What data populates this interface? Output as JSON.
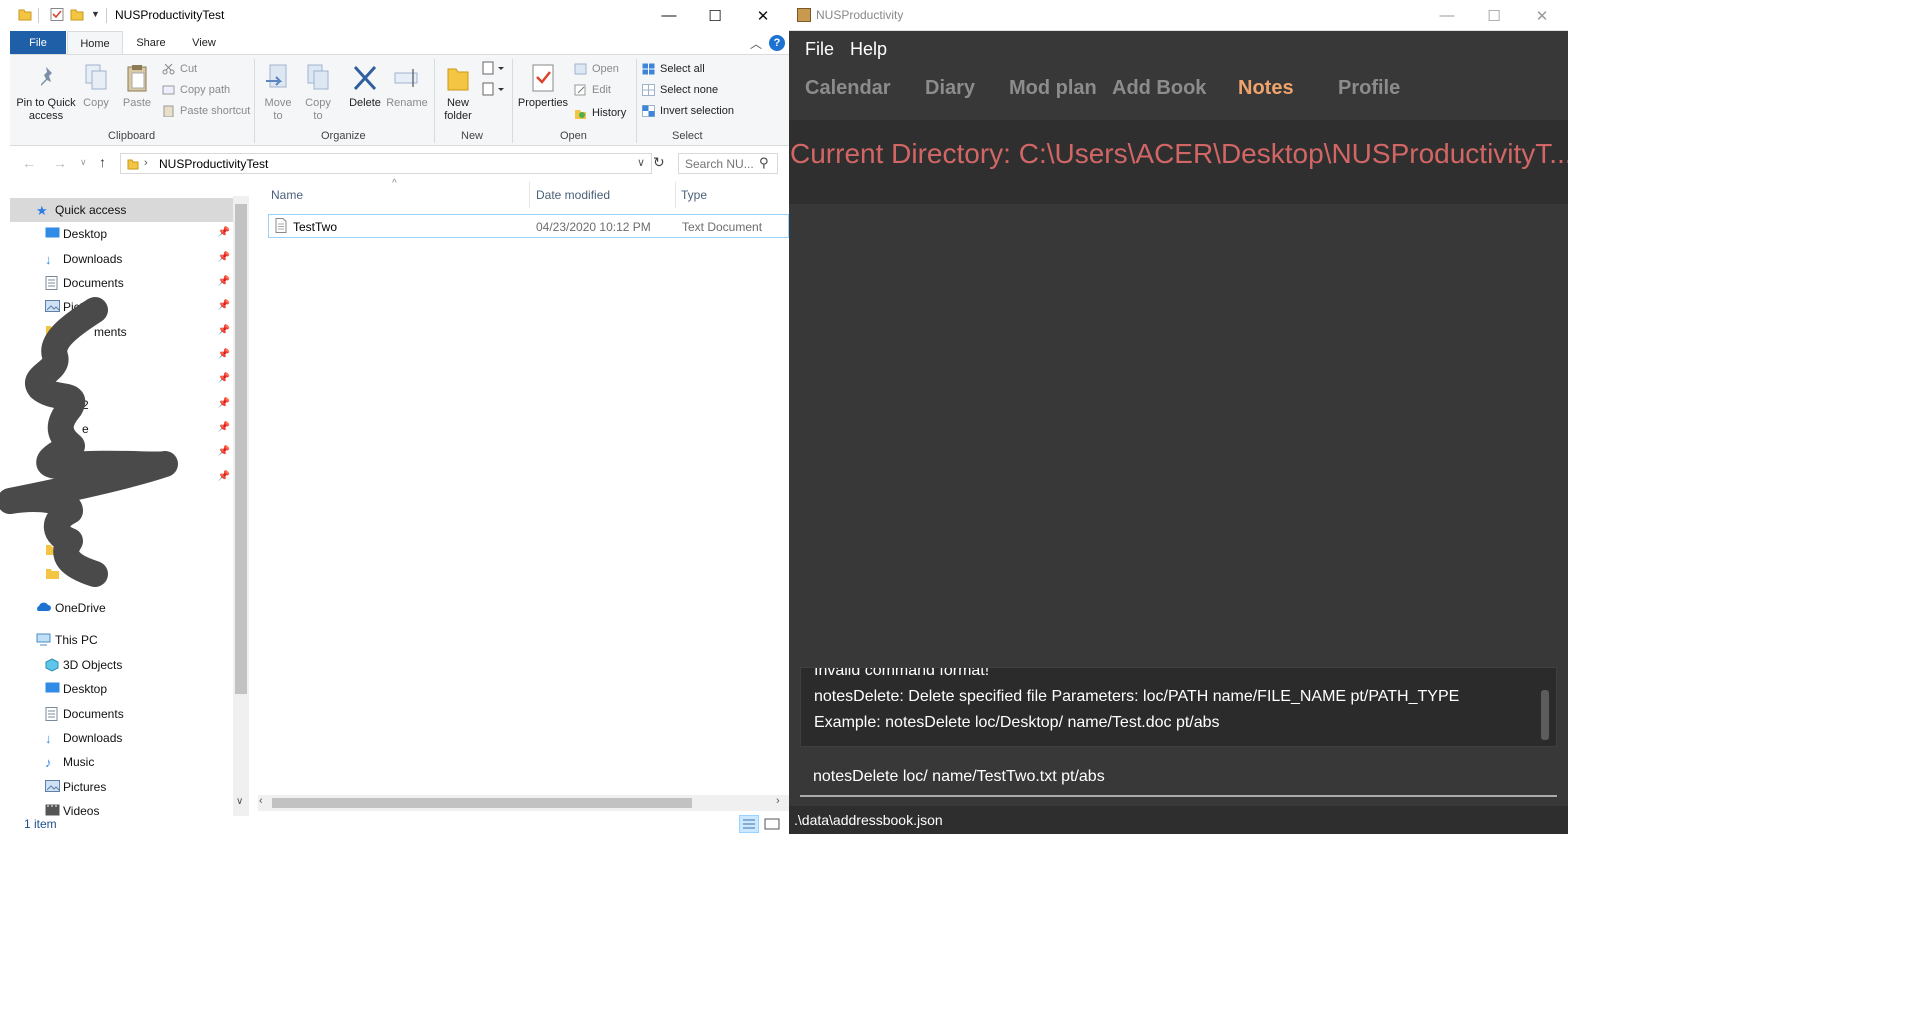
{
  "explorer": {
    "window_title": "NUSProductivityTest",
    "window_controls": {
      "minimize": "—",
      "maximize": "☐",
      "close": "✕"
    },
    "ribbon_tabs": [
      "File",
      "Home",
      "Share",
      "View"
    ],
    "help": "?",
    "clipboard": {
      "pin": "Pin to Quick access",
      "copy": "Copy",
      "paste": "Paste",
      "cut": "Cut",
      "copy_path": "Copy path",
      "paste_shortcut": "Paste shortcut",
      "label": "Clipboard"
    },
    "organize": {
      "move_to": "Move to",
      "copy_to": "Copy to",
      "delete": "Delete",
      "rename": "Rename",
      "label": "Organize"
    },
    "new_group": {
      "new_folder": "New folder",
      "label": "New"
    },
    "open_group": {
      "properties": "Properties",
      "open": "Open",
      "edit": "Edit",
      "history": "History",
      "label": "Open"
    },
    "select_group": {
      "select_all": "Select all",
      "select_none": "Select none",
      "invert": "Invert selection",
      "label": "Select"
    },
    "address": {
      "path": "NUSProductivityTest",
      "search_placeholder": "Search NU..."
    },
    "nav": [
      {
        "label": "Quick access",
        "icon": "star-icon"
      },
      {
        "label": "Desktop",
        "icon": "desktop-icon"
      },
      {
        "label": "Downloads",
        "icon": "download-icon"
      },
      {
        "label": "Documents",
        "icon": "documents-icon"
      },
      {
        "label": "Pict",
        "icon": "pictures-icon"
      },
      {
        "label": "ments",
        "icon": "folder-icon"
      },
      {
        "label": "2",
        "icon": "folder-icon"
      },
      {
        "label": "e",
        "icon": "folder-icon"
      },
      {
        "label": "OneDrive",
        "icon": "cloud-icon"
      },
      {
        "label": "This PC",
        "icon": "computer-icon"
      },
      {
        "label": "3D Objects",
        "icon": "cube-icon"
      },
      {
        "label": "Desktop",
        "icon": "desktop-icon"
      },
      {
        "label": "Documents",
        "icon": "documents-icon"
      },
      {
        "label": "Downloads",
        "icon": "download-icon"
      },
      {
        "label": "Music",
        "icon": "music-icon"
      },
      {
        "label": "Pictures",
        "icon": "pictures-icon"
      },
      {
        "label": "Videos",
        "icon": "video-icon"
      }
    ],
    "columns": [
      "Name",
      "Date modified",
      "Type"
    ],
    "files": [
      {
        "name": "TestTwo",
        "date": "04/23/2020 10:12 PM",
        "type": "Text Document"
      }
    ],
    "status": "1 item"
  },
  "app": {
    "window_title": "NUSProductivity",
    "window_controls": {
      "minimize": "—",
      "maximize": "☐",
      "close": "✕"
    },
    "menu": [
      "File",
      "Help"
    ],
    "tabs": [
      "Calendar",
      "Diary",
      "Mod plan",
      "Add Book",
      "Notes",
      "Profile"
    ],
    "active_tab": "Notes",
    "current_directory": "Current Directory: C:\\Users\\ACER\\Desktop\\NUSProductivityT...",
    "result_lines": [
      "Invalid command format!",
      "notesDelete: Delete specified file Parameters: loc/PATH name/FILE_NAME pt/PATH_TYPE",
      "Example: notesDelete loc/Desktop/ name/Test.doc pt/abs"
    ],
    "command_input": "notesDelete loc/ name/TestTwo.txt pt/abs",
    "status_path": ".\\data\\addressbook.json",
    "colors": {
      "active_tab": "#f0a36c",
      "directory_text": "#d16665",
      "background": "#383838"
    }
  }
}
